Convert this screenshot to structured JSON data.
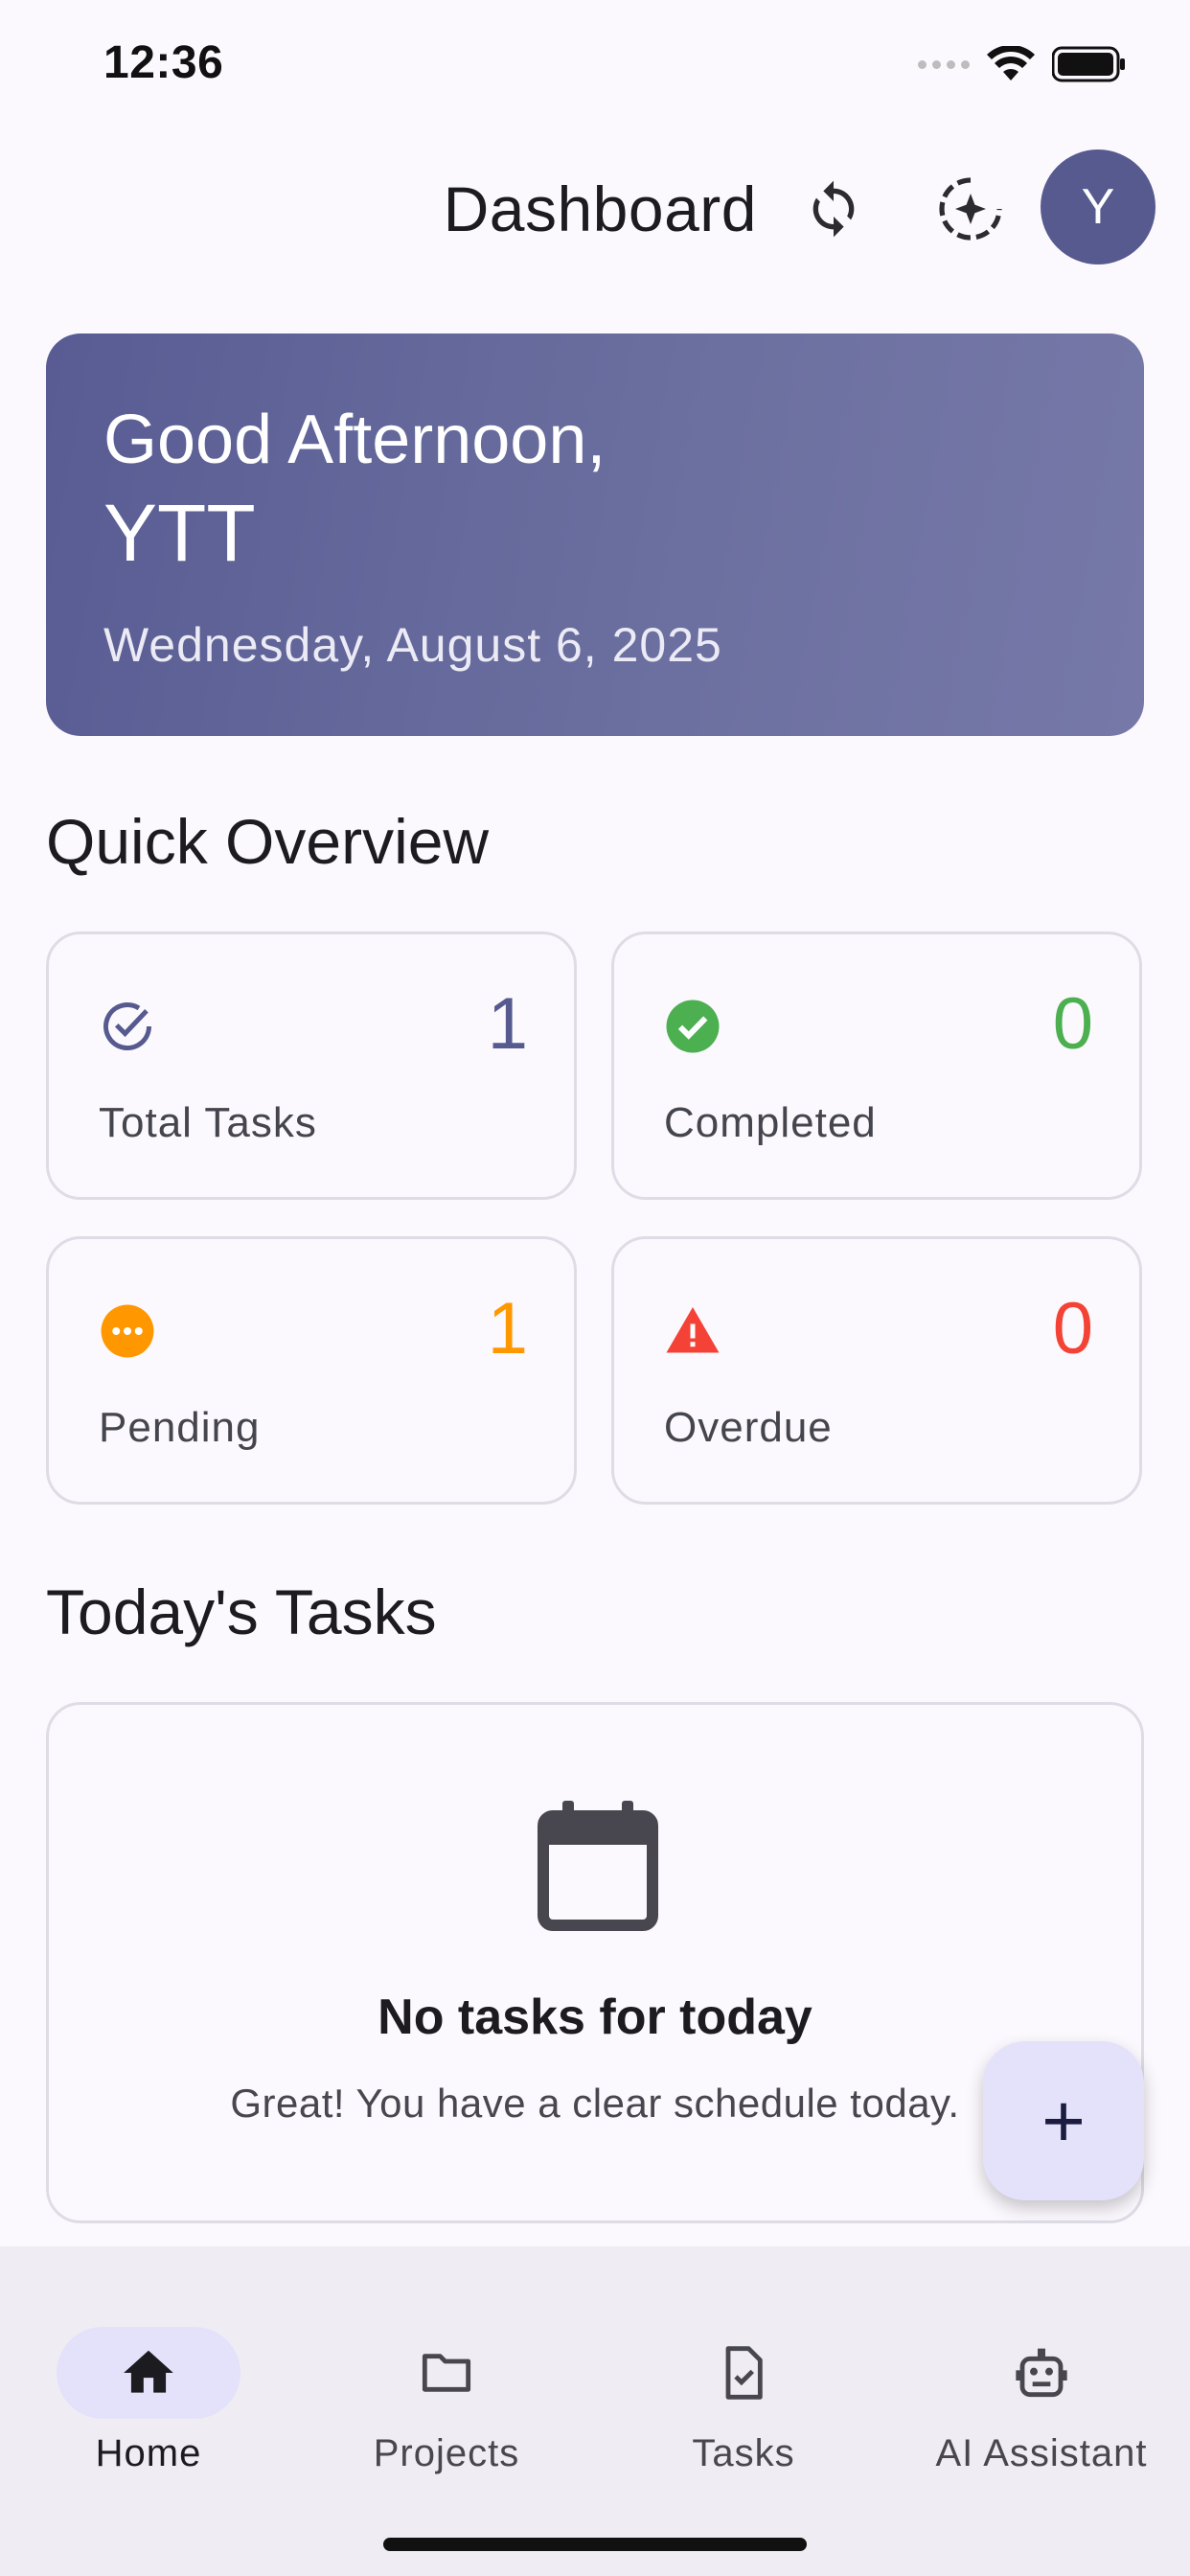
{
  "status_bar": {
    "time": "12:36"
  },
  "app_bar": {
    "title": "Dashboard",
    "avatar_initial": "Y",
    "icons": [
      "sync-icon",
      "ai-sparkle-icon"
    ]
  },
  "greeting": {
    "line1": "Good Afternoon,",
    "name": "YTT",
    "date": "Wednesday, August 6, 2025"
  },
  "quick_overview": {
    "title": "Quick Overview",
    "cards": [
      {
        "label": "Total Tasks",
        "value": "1",
        "color": "#565a8f",
        "icon": "check-circle-outline-icon"
      },
      {
        "label": "Completed",
        "value": "0",
        "color": "#4caf50",
        "icon": "check-circle-filled-icon"
      },
      {
        "label": "Pending",
        "value": "1",
        "color": "#ff9800",
        "icon": "pending-icon"
      },
      {
        "label": "Overdue",
        "value": "0",
        "color": "#f44336",
        "icon": "warning-icon"
      }
    ]
  },
  "todays_tasks": {
    "title": "Today's Tasks",
    "empty_title": "No tasks for today",
    "empty_subtitle": "Great! You have a clear schedule today."
  },
  "fab": {
    "label": "+"
  },
  "bottom_nav": {
    "items": [
      {
        "label": "Home",
        "icon": "home-icon",
        "active": true
      },
      {
        "label": "Projects",
        "icon": "folder-icon",
        "active": false
      },
      {
        "label": "Tasks",
        "icon": "task-icon",
        "active": false
      },
      {
        "label": "AI Assistant",
        "icon": "robot-icon",
        "active": false
      }
    ]
  }
}
